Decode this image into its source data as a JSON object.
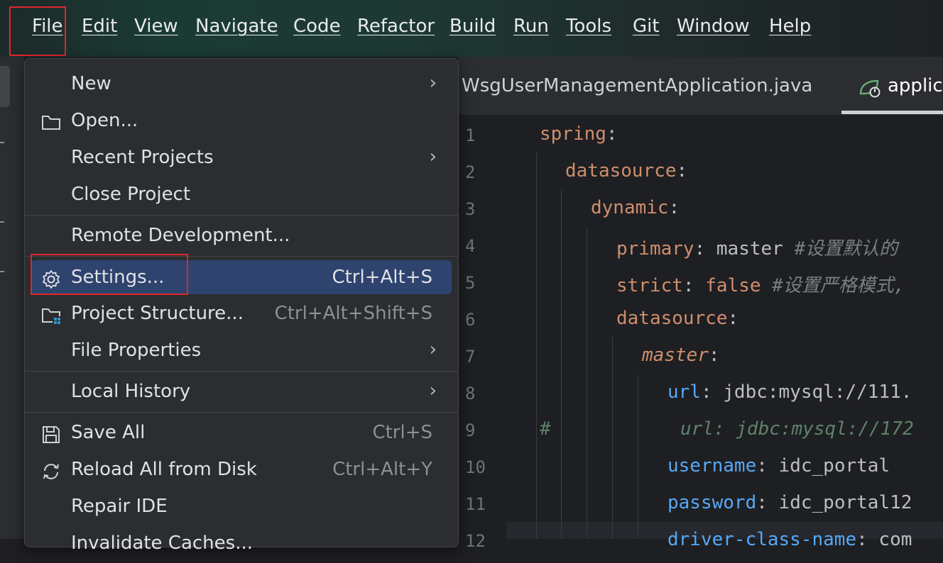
{
  "menubar": {
    "items": [
      "File",
      "Edit",
      "View",
      "Navigate",
      "Code",
      "Refactor",
      "Build",
      "Run",
      "Tools",
      "Git",
      "Window",
      "Help"
    ]
  },
  "editor": {
    "tabs": [
      "WsgUserManagementApplication.java",
      "applica"
    ],
    "line_numbers": [
      "1",
      "2",
      "3",
      "4",
      "5",
      "6",
      "7",
      "8",
      "9",
      "10",
      "11",
      "12"
    ],
    "lines": [
      {
        "key": "spring",
        "sep": ":",
        "value": "",
        "comment": ""
      },
      {
        "key": "datasource",
        "sep": ":",
        "value": "",
        "comment": ""
      },
      {
        "key": "dynamic",
        "sep": ":",
        "value": "",
        "comment": ""
      },
      {
        "key": "primary",
        "sep": ": ",
        "value": "master ",
        "comment": "#设置默认的"
      },
      {
        "key": "strict",
        "sep": ": ",
        "value": "false ",
        "comment": "#设置严格模式,"
      },
      {
        "key": "datasource",
        "sep": ":",
        "value": "",
        "comment": ""
      },
      {
        "key": "master",
        "sep": ":",
        "value": "",
        "comment": ""
      },
      {
        "key": "url",
        "sep": ": ",
        "value": "jdbc:mysql://111.",
        "comment": ""
      },
      {
        "key": "#",
        "sep": "",
        "value": "",
        "comment": "url: jdbc:mysql://172"
      },
      {
        "key": "username",
        "sep": ": ",
        "value": "idc_portal",
        "comment": ""
      },
      {
        "key": "password",
        "sep": ": ",
        "value": "idc_portal12",
        "comment": ""
      },
      {
        "key": "driver-class-name",
        "sep": ": ",
        "value": "com",
        "comment": ""
      }
    ]
  },
  "file_menu": {
    "items": [
      {
        "label": "New",
        "shortcut": "",
        "submenu": true,
        "icon": ""
      },
      {
        "label": "Open...",
        "shortcut": "",
        "submenu": false,
        "icon": "folder-icon"
      },
      {
        "label": "Recent Projects",
        "shortcut": "",
        "submenu": true,
        "icon": ""
      },
      {
        "label": "Close Project",
        "shortcut": "",
        "submenu": false,
        "icon": ""
      },
      {
        "label": "Remote Development...",
        "shortcut": "",
        "submenu": false,
        "icon": ""
      },
      {
        "label": "Settings...",
        "shortcut": "Ctrl+Alt+S",
        "submenu": false,
        "icon": "gear-icon",
        "selected": true
      },
      {
        "label": "Project Structure...",
        "shortcut": "Ctrl+Alt+Shift+S",
        "submenu": false,
        "icon": "project-structure-icon"
      },
      {
        "label": "File Properties",
        "shortcut": "",
        "submenu": true,
        "icon": ""
      },
      {
        "label": "Local History",
        "shortcut": "",
        "submenu": true,
        "icon": ""
      },
      {
        "label": "Save All",
        "shortcut": "Ctrl+S",
        "submenu": false,
        "icon": "save-icon"
      },
      {
        "label": "Reload All from Disk",
        "shortcut": "Ctrl+Alt+Y",
        "submenu": false,
        "icon": "reload-icon"
      },
      {
        "label": "Repair IDE",
        "shortcut": "",
        "submenu": false,
        "icon": ""
      },
      {
        "label": "Invalidate Caches...",
        "shortcut": "",
        "submenu": false,
        "icon": ""
      }
    ]
  },
  "colors": {
    "accent_selected": "#2e436e",
    "highlight_box": "#e0262b"
  }
}
